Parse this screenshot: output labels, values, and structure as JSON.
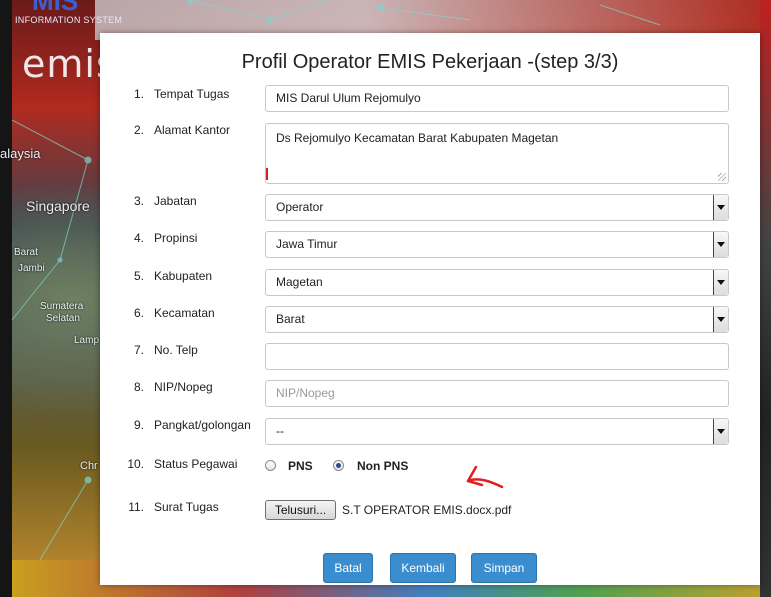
{
  "background": {
    "logo_sub": "INFORMATION SYSTEM",
    "logo_main": "emis",
    "logo_top": "MIS",
    "map_labels": [
      "alaysia",
      "Singapore",
      "Barat",
      "Jambi",
      "Sumatera",
      "Selatan",
      "Lamp",
      "Chr"
    ]
  },
  "modal": {
    "title": "Profil Operator EMIS Pekerjaan -(step 3/3)",
    "fields": [
      {
        "num": "1.",
        "label": "Tempat Tugas",
        "value": "MIS Darul Ulum Rejomulyo"
      },
      {
        "num": "2.",
        "label": "Alamat Kantor",
        "value": "Ds Rejomulyo Kecamatan Barat Kabupaten Magetan"
      },
      {
        "num": "3.",
        "label": "Jabatan",
        "value": "Operator"
      },
      {
        "num": "4.",
        "label": "Propinsi",
        "value": "Jawa Timur"
      },
      {
        "num": "5.",
        "label": "Kabupaten",
        "value": "Magetan"
      },
      {
        "num": "6.",
        "label": "Kecamatan",
        "value": "Barat"
      },
      {
        "num": "7.",
        "label": "No. Telp",
        "value": ""
      },
      {
        "num": "8.",
        "label": "NIP/Nopeg",
        "placeholder": "NIP/Nopeg"
      },
      {
        "num": "9.",
        "label": "Pangkat/golongan",
        "value": "--"
      },
      {
        "num": "10.",
        "label": "Status Pegawai",
        "options": [
          "PNS",
          "Non PNS"
        ],
        "selected": "Non PNS"
      },
      {
        "num": "11.",
        "label": "Surat Tugas",
        "button": "Telusuri...",
        "file": "S.T OPERATOR EMIS.docx.pdf"
      }
    ],
    "buttons": {
      "cancel": "Batal",
      "back": "Kembali",
      "save": "Simpan"
    },
    "colors": {
      "button": "#3a8ed0",
      "annotation": "#e02020"
    }
  }
}
